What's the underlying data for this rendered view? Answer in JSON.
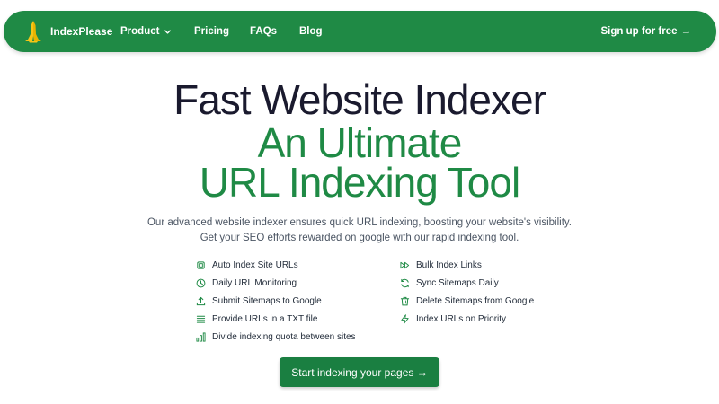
{
  "colors": {
    "brand_green": "#1f8a45",
    "heading_dark": "#1a1a2e",
    "text_gray": "#4b5563"
  },
  "nav": {
    "brand": "IndexPlease",
    "logo_icon": "hands-logo",
    "items": [
      {
        "label": "Product",
        "has_dropdown": true
      },
      {
        "label": "Pricing"
      },
      {
        "label": "FAQs"
      },
      {
        "label": "Blog"
      }
    ],
    "signup_label": "Sign up for free",
    "signup_arrow": "→"
  },
  "hero": {
    "title_line1": "Fast Website Indexer",
    "title_line2": "An Ultimate",
    "title_line3": "URL Indexing Tool",
    "subtitle_line1": "Our advanced website indexer ensures quick URL indexing, boosting your website's visibility.",
    "subtitle_line2": "Get your SEO efforts rewarded on google with our rapid indexing tool."
  },
  "features": {
    "left": [
      {
        "label": "Auto Index Site URLs",
        "icon": "chip-icon"
      },
      {
        "label": "Daily URL Monitoring",
        "icon": "clock-icon"
      },
      {
        "label": "Submit Sitemaps to Google",
        "icon": "upload-icon"
      },
      {
        "label": "Provide URLs in a TXT file",
        "icon": "list-icon"
      },
      {
        "label": "Divide indexing quota between sites",
        "icon": "bar-chart-icon"
      }
    ],
    "right": [
      {
        "label": "Bulk Index Links",
        "icon": "fast-forward-icon"
      },
      {
        "label": "Sync Sitemaps Daily",
        "icon": "refresh-icon"
      },
      {
        "label": "Delete Sitemaps from Google",
        "icon": "trash-icon"
      },
      {
        "label": "Index URLs on Priority",
        "icon": "lightning-icon"
      }
    ]
  },
  "cta": {
    "label": "Start indexing your pages →"
  }
}
